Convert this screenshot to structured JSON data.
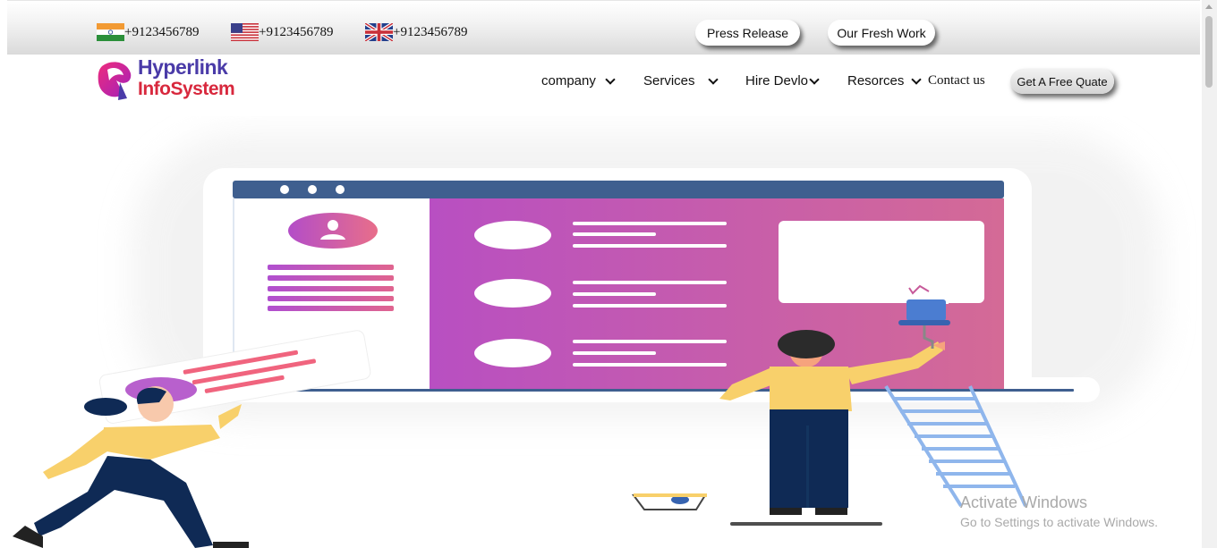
{
  "topbar": {
    "phones": [
      {
        "country": "India",
        "flag_icon": "india-flag-icon",
        "number": "+9123456789"
      },
      {
        "country": "USA",
        "flag_icon": "usa-flag-icon",
        "number": "+9123456789"
      },
      {
        "country": "UK",
        "flag_icon": "uk-flag-icon",
        "number": "+9123456789"
      }
    ],
    "press_release": "Press Release",
    "fresh_work": "Our Fresh Work"
  },
  "logo": {
    "line1": "Hyperlink",
    "line2": "InfoSystem"
  },
  "nav": {
    "items": [
      {
        "label": "company",
        "has_dropdown": true
      },
      {
        "label": "Services",
        "has_dropdown": true
      },
      {
        "label": "Hire Devlo",
        "has_dropdown": true
      },
      {
        "label": "Resorces",
        "has_dropdown": true
      },
      {
        "label": "Contact us",
        "has_dropdown": false
      }
    ],
    "cta": "Get A Free Quate"
  },
  "watermark": {
    "title": "Activate Windows",
    "subtitle": "Go to Settings to activate Windows."
  },
  "colors": {
    "brand_purple": "#4a3ba8",
    "brand_red": "#d8283d",
    "screen_gradient_start": "#b84fc2",
    "screen_gradient_end": "#d46a96",
    "window_bar": "#3f5f8f"
  }
}
